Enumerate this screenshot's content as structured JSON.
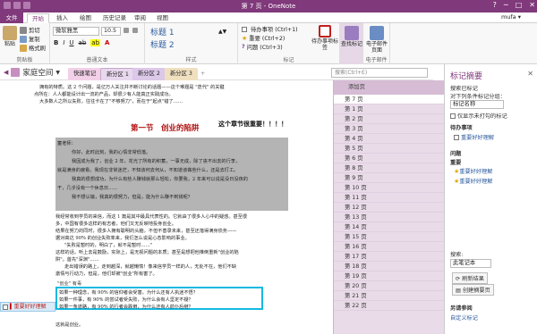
{
  "window": {
    "title": "第 7 页 - OneNote",
    "controls": [
      "?",
      "─",
      "□",
      "✕"
    ]
  },
  "tabs": [
    "文件",
    "开始",
    "插入",
    "绘图",
    "历史记录",
    "审阅",
    "视图"
  ],
  "user": "mufa ▾",
  "ribbon": {
    "paste": "粘贴",
    "cut": "剪切",
    "copy": "复制",
    "format_painter": "格式刷",
    "clipboard_label": "剪贴板",
    "font_name": "微软雅黑",
    "font_size": "10.5",
    "basic_text_label": "普通文本",
    "style1": "标题 1",
    "style2": "标题 2",
    "styles_label": "样式",
    "tag_todo": "待办事项 (Ctrl+1)",
    "tag_important": "重要 (Ctrl+2)",
    "tag_question": "问题 (Ctrl+3)",
    "tags_label": "标记",
    "todo_btn": "待办事项标签",
    "find_tags_btn": "查找标记",
    "email_btn": "电子邮件页面",
    "email_label": "电子邮件"
  },
  "notebook": {
    "name": "家庭空间"
  },
  "sections": [
    "快速笔记",
    "新分区 1",
    "新分区 2",
    "新分区 3"
  ],
  "search_placeholder": "搜索(Ctrl+E)",
  "page_header": "添加页",
  "pages": [
    "第 7 页",
    "第 1 页",
    "第 2 页",
    "第 3 页",
    "第 4 页",
    "第 5 页",
    "第 6 页",
    "第 8 页",
    "第 9 页",
    "第 10 页",
    "第 11 页",
    "第 12 页",
    "第 13 页",
    "第 14 页",
    "第 15 页",
    "第 16 页",
    "第 17 页",
    "第 18 页",
    "第 19 页",
    "第 20 页",
    "第 21 页",
    "第 22 页"
  ],
  "content": {
    "lines_top": [
      "拥有的特质。这 2 个问题，是亿万人关注并不断讨论的话题——这个难题是 \"迭代\" 的关键",
      "点所在：人人都能设计出一流的产品，却很少有人能真正实践成功。",
      "大多数人之所以失败，往往卡在了\"不够努力\"，而在于\"起点\"错了……"
    ],
    "chapter": "第一节　创业的陷阱",
    "note": "这个章节很重要！！！！",
    "gray_lines": [
      "童老师：",
      "你好，此时此刻，我的心情非常低落。",
      "我因成为我了，创业 2 年，花光了所有的积蓄，一事无成，除了丧不出去的行李，",
      "就是满身的疲惫。我现在非常迷茫，不知该何去何从，不知道该做些什么，还是去打工。",
      "我真的很想成功，为什么有些人赚钱就那么轻松，你要我，2 年来可以说是没日没夜的",
      "干，几乎没有一个休息日……",
      "我不想认输，我真的很努力，但是，能为什么赚不到钱呢？"
    ],
    "lines_mid": [
      "我经常收到学员的来信，而这 1 篇是其中最具代表性的。它就由了很多人心中的疑惑。甚至很",
      "多，中国有很多这样的有志者，他们又无反映地投身创业。",
      "结果在努力的同时，很多人拥有聪明的头脑，不但不善录未来，甚至还落得满身债务——",
      "据对高达 90% 的创业失败率来，我们怎么说是心态影响的事业。",
      "\"失败是暂时的，明白了，就不是暂时……\"",
      "这样的话，听上去是鼓励，实际上，是无视问题的本质；甚至是想把他推倒重新\"创业的陷",
      "阱\"。首先\"深渊\"……",
      "走出错误的路上，走到越深，就越懒惰！像来信学员一样的人，无处不在，他们不缺",
      "激情与行动力，但是，他们却被\"创业\"所有害了。"
    ],
    "tag_label": "\"创业\" 有毒",
    "highlight_lines": [
      "如果一种理念，有 90% 的信仰者会受害，为什么还有人执迷不悟？",
      "如果一件事，有 90% 的尝试者受失败，为什么会有人坚定不疑？",
      "如果一条道路，有 90% 的行者会跌倒，为什么还有人前仆后继？"
    ],
    "bottom_line": "这就是创业。",
    "flag_label": "重要好好理解"
  },
  "tags_panel": {
    "title": "标记摘要",
    "group_by_label": "搜索已标记",
    "group_by_text": "对下列条件标记分组：",
    "group_value": "标记名称",
    "show_unchecked": "仅显示未打勾的标记",
    "group_todo": "待办事项",
    "todo_item": "重要好好理解",
    "group_question": "问题",
    "group_important": "重要",
    "important_items": [
      "重要好好理解",
      "重要好好理解"
    ],
    "search_label": "搜索:",
    "search_scope": "此笔记本",
    "refresh": "刷新结果",
    "create_summary": "创建摘要页",
    "other_link": "另请参阅",
    "custom_tags": "自定义标记"
  },
  "colors": {
    "accent": "#80397b",
    "chapter": "#b01010",
    "gray_box": "#b4b4b4",
    "highlight_border": "#13b9e0",
    "pages_bg": "#e9dbe8"
  }
}
